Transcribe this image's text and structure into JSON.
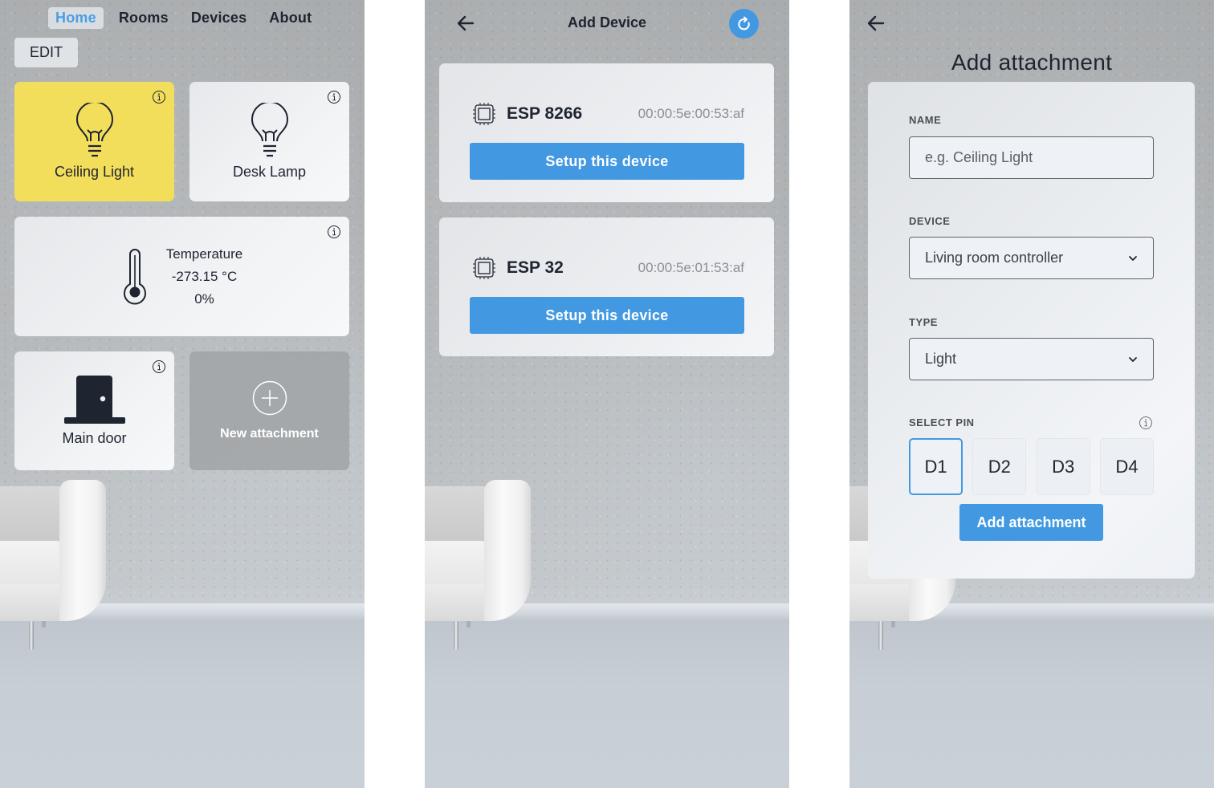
{
  "home": {
    "nav": [
      {
        "label": "Home",
        "active": true
      },
      {
        "label": "Rooms",
        "active": false
      },
      {
        "label": "Devices",
        "active": false
      },
      {
        "label": "About",
        "active": false
      }
    ],
    "edit_label": "EDIT",
    "tiles": {
      "ceiling_light": {
        "label": "Ceiling Light",
        "state": "on",
        "icon": "lightbulb-icon"
      },
      "desk_lamp": {
        "label": "Desk Lamp",
        "state": "off",
        "icon": "lightbulb-icon"
      },
      "temperature": {
        "title": "Temperature",
        "value": "-273.15 °C",
        "humidity": "0%",
        "icon": "thermometer-icon"
      },
      "main_door": {
        "label": "Main door",
        "icon": "door-icon"
      },
      "new_attachment": {
        "label": "New attachment",
        "icon": "plus-circle-icon"
      }
    },
    "colors": {
      "active_tile": "#f3de5c",
      "accent": "#4a9ee6"
    }
  },
  "add_device": {
    "title": "Add Device",
    "devices": [
      {
        "name": "ESP 8266",
        "mac": "00:00:5e:00:53:af",
        "button": "Setup this device"
      },
      {
        "name": "ESP 32",
        "mac": "00:00:5e:01:53:af",
        "button": "Setup this device"
      }
    ],
    "colors": {
      "primary": "#4299e1"
    }
  },
  "add_attachment": {
    "title": "Add attachment",
    "name_label": "NAME",
    "name_placeholder": "e.g. Ceiling Light",
    "name_value": "",
    "device_label": "DEVICE",
    "device_value": "Living room controller",
    "type_label": "TYPE",
    "type_value": "Light",
    "pin_label": "SELECT PIN",
    "pins": [
      {
        "label": "D1",
        "selected": true
      },
      {
        "label": "D2",
        "selected": false
      },
      {
        "label": "D3",
        "selected": false
      },
      {
        "label": "D4",
        "selected": false
      }
    ],
    "submit_label": "Add attachment"
  }
}
